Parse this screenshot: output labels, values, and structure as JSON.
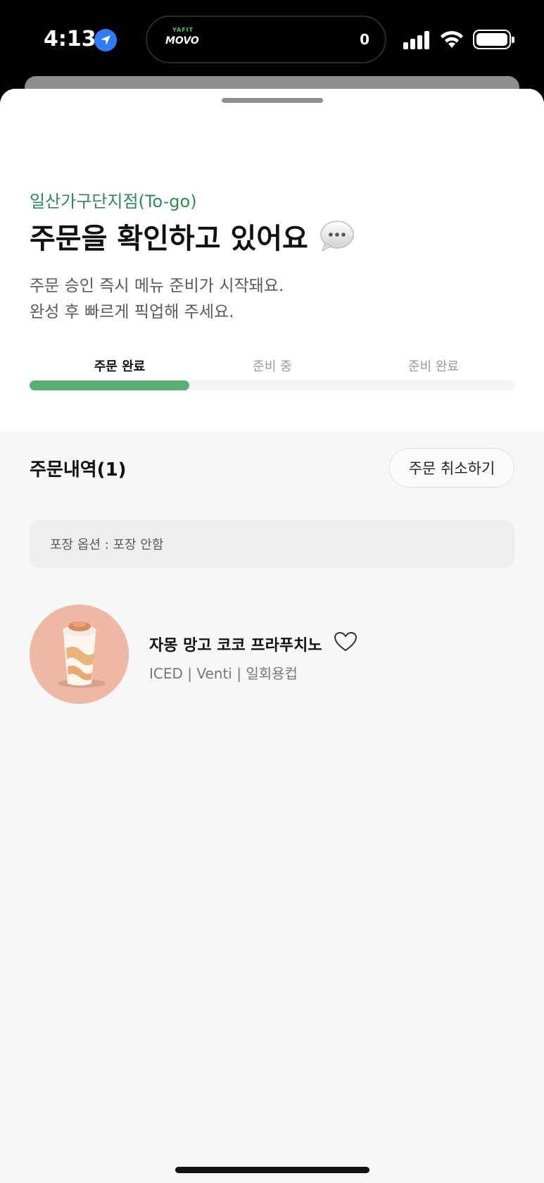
{
  "status_bar": {
    "time": "4:13",
    "island_logo_top": "YAFIT",
    "island_logo_main": "MOVO",
    "island_count": "0",
    "icons": [
      "location-arrow-icon",
      "cellular-signal-icon",
      "wifi-icon",
      "battery-icon"
    ]
  },
  "order_status": {
    "store_name": "일산가구단지점(To-go)",
    "headline": "주문을 확인하고 있어요",
    "headline_icon": "speech-bubble-icon",
    "description_lines": [
      "주문 승인 즉시 메뉴 준비가 시작돼요.",
      "완성 후 빠르게 픽업해 주세요."
    ],
    "steps": [
      {
        "label": "주문 완료",
        "active": true
      },
      {
        "label": "준비 중",
        "active": false
      },
      {
        "label": "준비 완료",
        "active": false
      }
    ],
    "progress_fraction": 0.33
  },
  "order_history": {
    "title": "주문내역(1)",
    "cancel_label": "주문 취소하기",
    "packaging_option": "포장 옵션 : 포장 안함",
    "items": [
      {
        "name": "자몽 망고 코코 프라푸치노",
        "options": "ICED | Venti | 일회용컵",
        "favorite": false
      }
    ]
  },
  "colors": {
    "accent_green": "#58b077",
    "store_green": "#2e8b57",
    "product_bg": "#efb7a4"
  }
}
